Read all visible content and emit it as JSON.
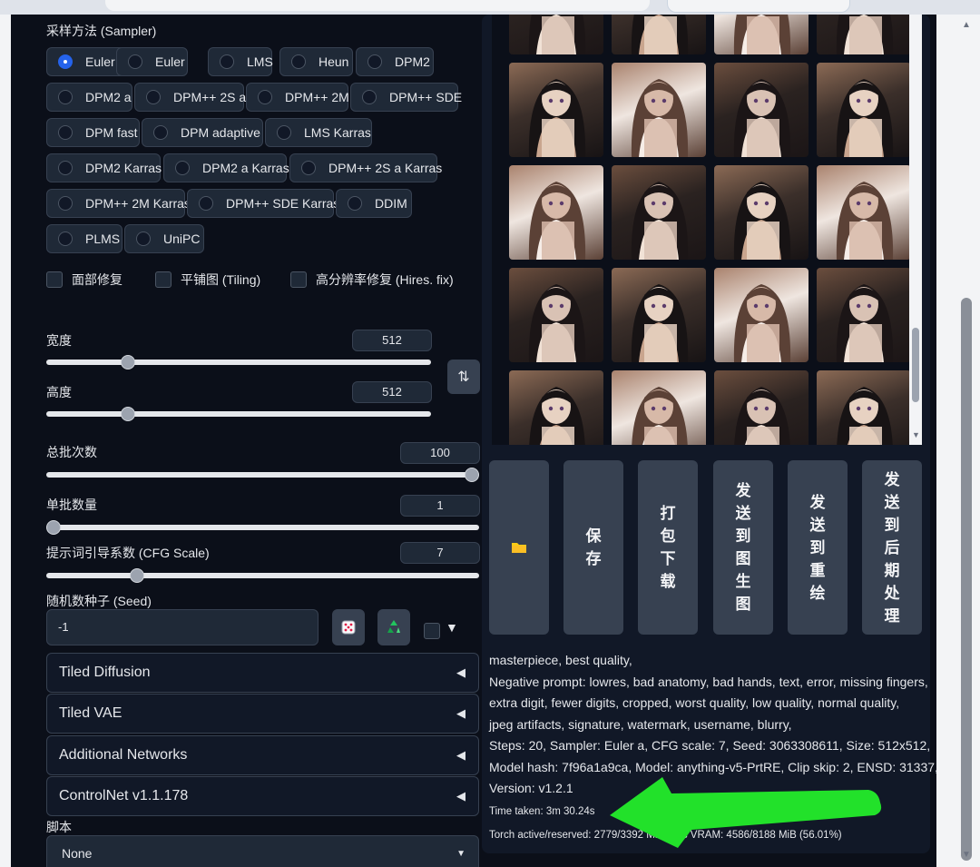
{
  "sampler": {
    "label": "采样方法 (Sampler)",
    "options": [
      "Euler a",
      "Euler",
      "LMS",
      "Heun",
      "DPM2",
      "DPM2 a",
      "DPM++ 2S a",
      "DPM++ 2M",
      "DPM++ SDE",
      "DPM fast",
      "DPM adaptive",
      "LMS Karras",
      "DPM2 Karras",
      "DPM2 a Karras",
      "DPM++ 2S a Karras",
      "DPM++ 2M Karras",
      "DPM++ SDE Karras",
      "DDIM",
      "PLMS",
      "UniPC"
    ],
    "selected": "Euler a"
  },
  "checkboxes": {
    "face_restore": "面部修复",
    "tiling": "平铺图 (Tiling)",
    "hires_fix": "高分辨率修复 (Hires. fix)"
  },
  "width": {
    "label": "宽度",
    "value": "512"
  },
  "height": {
    "label": "高度",
    "value": "512"
  },
  "batch_count": {
    "label": "总批次数",
    "value": "100"
  },
  "batch_size": {
    "label": "单批数量",
    "value": "1"
  },
  "cfg": {
    "label": "提示词引导系数 (CFG Scale)",
    "value": "7"
  },
  "seed": {
    "label": "随机数种子 (Seed)",
    "value": "-1"
  },
  "accordions": {
    "tiled_diffusion": "Tiled Diffusion",
    "tiled_vae": "Tiled VAE",
    "additional_networks": "Additional Networks",
    "controlnet": "ControlNet v1.1.178"
  },
  "script": {
    "label": "脚本",
    "value": "None"
  },
  "actions": {
    "save": "保存",
    "zip": "打包下载",
    "to_img2img": "发送到图生图",
    "to_inpaint": "发送到重绘",
    "to_extras": "发送到后期处理"
  },
  "info": {
    "prompt": "masterpiece, best quality,",
    "negative1": "Negative prompt: lowres, bad anatomy, bad hands, text, error, missing fingers,",
    "negative2": "extra digit, fewer digits, cropped, worst quality, low quality, normal quality,",
    "negative3": "jpeg artifacts, signature, watermark, username, blurry,",
    "params1": "Steps: 20, Sampler: Euler a, CFG scale: 7, Seed: 3063308611, Size: 512x512,",
    "params2": "Model hash: 7f96a1a9ca, Model: anything-v5-PrtRE, Clip skip: 2, ENSD: 31337,",
    "version": "Version: v1.2.1",
    "time_taken": "Time taken: 3m 30.24s",
    "torch": "Torch active/reserved: 2779/3392 MiB, Sys VRAM: 4586/8188 MiB (56.01%)"
  },
  "sliders": {
    "width_fraction": 0.2,
    "height_fraction": 0.2,
    "batch_count_fraction": 1.0,
    "batch_size_fraction": 0.0,
    "cfg_fraction": 0.2
  },
  "colors": {
    "background": "#0b0f19",
    "panel": "#1f2937",
    "accent": "#2563eb",
    "arrow": "#22e12a"
  },
  "icons": [
    "radio-selected-icon",
    "swap-icon",
    "dice-icon",
    "recycle-icon",
    "folder-icon",
    "chevron-down-icon",
    "triangle-left-icon"
  ]
}
